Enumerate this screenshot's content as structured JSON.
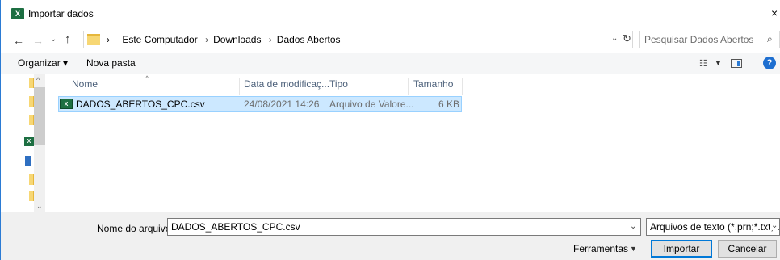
{
  "window": {
    "title": "Importar dados",
    "close_glyph": "×",
    "app_icon": "excel-icon"
  },
  "navigation": {
    "back_glyph": "←",
    "forward_glyph": "→",
    "recent_glyph": "⌄",
    "up_glyph": "↑"
  },
  "address": {
    "crumbs": [
      "Este Computador",
      "Downloads",
      "Dados Abertos"
    ],
    "crumb_separator": "›",
    "dropdown_glyph": "⌄",
    "refresh_glyph": "↻"
  },
  "search": {
    "placeholder": "Pesquisar Dados Abertos",
    "icon_glyph": "⌕"
  },
  "toolbar": {
    "organize_label": "Organizar ▾",
    "new_folder_label": "Nova pasta",
    "view_glyph": "☷",
    "view_dropdown_glyph": "▼",
    "help_glyph": "?"
  },
  "nav_pane": {
    "scroll_up_glyph": "^",
    "scroll_down_glyph": "⌄"
  },
  "file_list": {
    "sort_glyph": "^",
    "columns": [
      "Nome",
      "Data de modificaç...",
      "Tipo",
      "Tamanho"
    ],
    "rows": [
      {
        "name": "DADOS_ABERTOS_CPC.csv",
        "modified": "24/08/2021 14:26",
        "type": "Arquivo de Valore...",
        "size": "6 KB",
        "selected": true
      }
    ]
  },
  "footer": {
    "filename_label": "Nome do arquivo:",
    "filename_value": "DADOS_ABERTOS_CPC.csv",
    "filename_dropdown_glyph": "⌄",
    "filter_value": "Arquivos de texto (*.prn;*.txt;*.csv)",
    "filter_dropdown_glyph": "⌄",
    "tools_label": "Ferramentas",
    "tools_dropdown_glyph": "▼",
    "import_label": "Importar",
    "cancel_label": "Cancelar"
  },
  "colors": {
    "selection_bg": "#cce8ff",
    "selection_border": "#99d1ff",
    "accent": "#0078d7",
    "excel_green": "#1d6f42",
    "folder_yellow": "#f7d774"
  }
}
